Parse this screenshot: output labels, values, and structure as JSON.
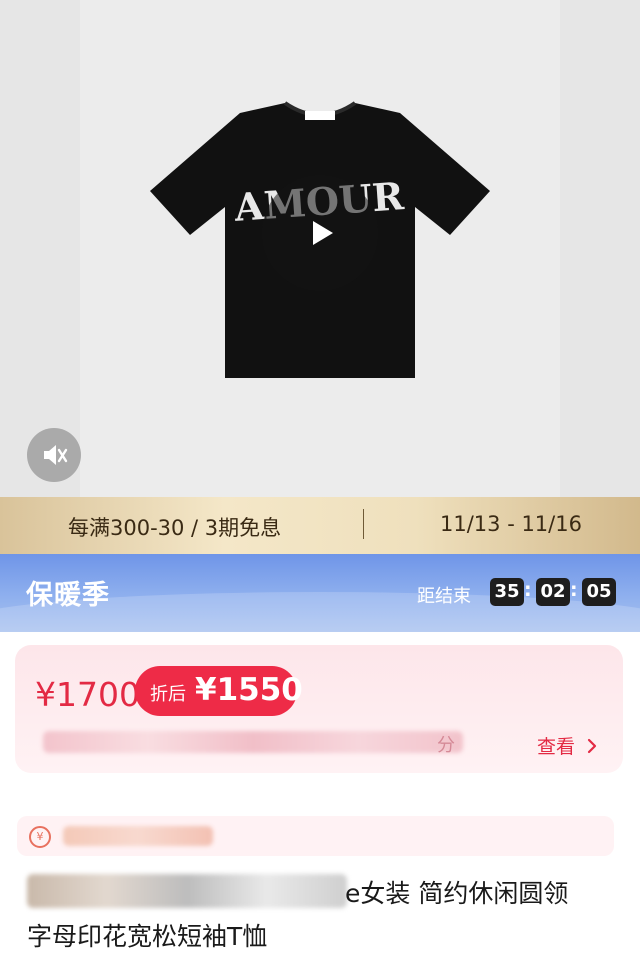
{
  "hero": {
    "shirt_print": "AMOUR",
    "shirt_color": "#111111",
    "play_icon": "play-icon",
    "mute_icon": "mute-icon"
  },
  "promo": {
    "offer": "每满300-30 / 3期免息",
    "dates": "11/13 - 11/16"
  },
  "season": {
    "title": "保暖季",
    "countdown_label": "距结束",
    "hours": "35",
    "minutes": "02",
    "seconds": "05"
  },
  "price": {
    "original": "¥1700",
    "discount_label": "折后",
    "discount_price": "¥1550",
    "info_tail": "分",
    "view_label": "查看",
    "accent": "#ee2b47"
  },
  "product": {
    "title_line1": "e女装 简约休闲圆领",
    "title_line2": "字母印花宽松短袖T恤"
  }
}
